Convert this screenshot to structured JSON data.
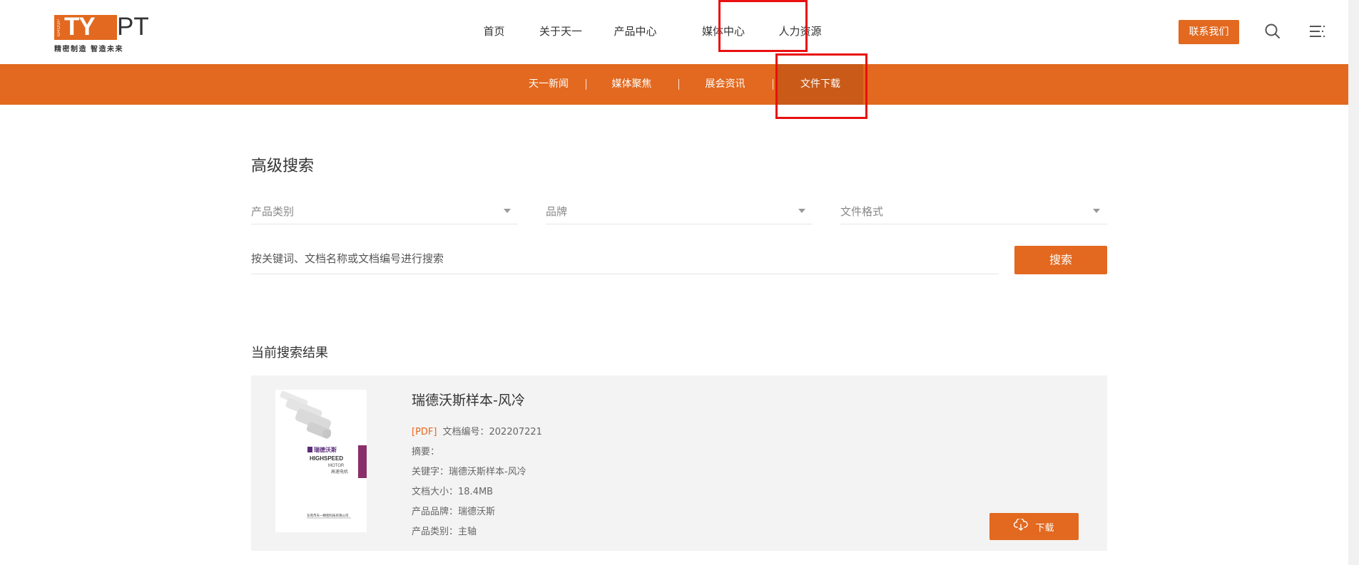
{
  "logo": {
    "group": "GROUP",
    "ty": "TY",
    "pt": "PT",
    "slogan": "精密制造 智造未来"
  },
  "main_nav": {
    "items": [
      {
        "label": "首页"
      },
      {
        "label": "关于天一"
      },
      {
        "label": "产品中心"
      },
      {
        "label": "媒体中心"
      },
      {
        "label": "人力资源"
      }
    ],
    "highlighted": "媒体中心"
  },
  "header": {
    "contact_label": "联系我们",
    "search_icon": "search-icon",
    "menu_icon": "menu-icon"
  },
  "sub_nav": {
    "items": [
      {
        "label": "天一新闻"
      },
      {
        "label": "媒体聚焦"
      },
      {
        "label": "展会资讯"
      },
      {
        "label": "文件下载"
      }
    ],
    "active": "文件下载"
  },
  "search": {
    "title": "高级搜索",
    "filters": [
      {
        "placeholder": "产品类别"
      },
      {
        "placeholder": "品牌"
      },
      {
        "placeholder": "文件格式"
      }
    ],
    "keyword_placeholder": "按关键词、文档名称或文档编号进行搜索",
    "button_label": "搜索"
  },
  "results": {
    "title": "当前搜索结果",
    "items": [
      {
        "title": "瑞德沃斯样本-风冷",
        "format": "[PDF]",
        "doc_no_label": "文档编号：",
        "doc_no": "202207221",
        "summary_label": "摘要：",
        "summary": "",
        "keywords_label": "关键字：",
        "keywords": "瑞德沃斯样本-风冷",
        "size_label": "文档大小：",
        "size": "18.4MB",
        "brand_label": "产品品牌：",
        "brand": "瑞德沃斯",
        "category_label": "产品类别：",
        "category": "主轴",
        "download_label": "下载",
        "thumbnail": {
          "brand_cn": "瑞德沃斯",
          "line1": "HIGHSPEED",
          "line2": "MOTOR",
          "line3": "高速电机",
          "footer": "东莞市天一精密科技有限公司"
        }
      }
    ]
  },
  "colors": {
    "brand_orange": "#e2691f",
    "active_sub": "#c95a18",
    "highlight_red": "#e81010",
    "card_bg": "#f3f3f3"
  }
}
